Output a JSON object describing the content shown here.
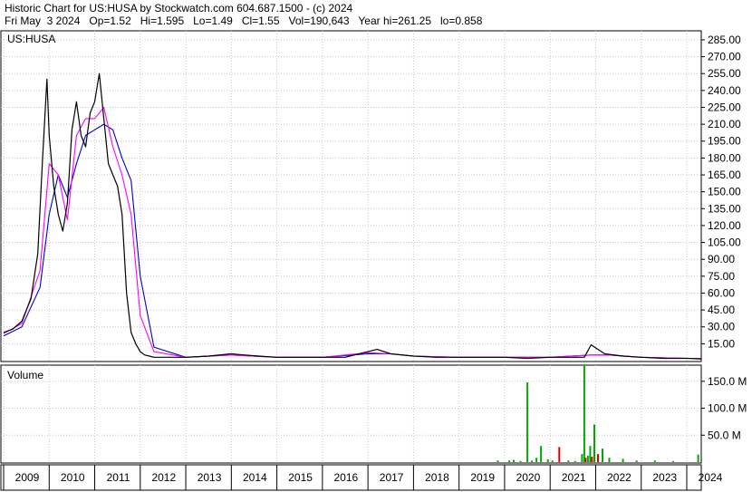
{
  "header": {
    "line1": "Historic Chart for US:HUSA by Stockwatch.com 604.687.1500 - (c) 2024",
    "line2": "Fri May  3 2024   Op=1.52   Hi=1.595   Lo=1.49   Cl=1.55   Vol=190,643   Year hi=261.25   lo=0.858"
  },
  "price_panel": {
    "symbol_label": "US:HUSA"
  },
  "volume_panel": {
    "label": "Volume"
  },
  "colors": {
    "price": "#000000",
    "ma_short": "#ff00ff",
    "ma_long": "#0000cc",
    "vol_up": "#00aa00",
    "vol_down": "#dd0000",
    "grid": "#c8c8c8"
  },
  "chart_data": [
    {
      "type": "line",
      "title": "",
      "xlabel": "",
      "ylabel": "",
      "ylim": [
        0,
        293
      ],
      "yticks": [
        "285.00",
        "270.00",
        "255.00",
        "240.00",
        "225.00",
        "210.00",
        "195.00",
        "180.00",
        "165.00",
        "150.00",
        "135.00",
        "120.00",
        "105.00",
        "90.00",
        "75.00",
        "60.00",
        "45.00",
        "30.00",
        "15.00"
      ],
      "xticks": [
        "2009",
        "2010",
        "2011",
        "2012",
        "2013",
        "2014",
        "2015",
        "2016",
        "2017",
        "2018",
        "2019",
        "2020",
        "2021",
        "2022",
        "2023",
        "2024"
      ],
      "grid": true,
      "series": [
        {
          "x": [
            2009.0,
            2009.2,
            2009.4,
            2009.6,
            2009.75,
            2009.85,
            2009.95,
            2010.0,
            2010.1,
            2010.2,
            2010.3,
            2010.4,
            2010.5,
            2010.6,
            2010.7,
            2010.8,
            2010.9,
            2011.0,
            2011.1,
            2011.2,
            2011.3,
            2011.4,
            2011.5,
            2011.6,
            2011.7,
            2011.8,
            2011.9,
            2012.0,
            2012.1,
            2012.2,
            2012.3,
            2012.5,
            2012.7,
            2013.0,
            2013.5,
            2014.0,
            2014.3,
            2014.6,
            2015.0,
            2015.5,
            2016.0,
            2016.5,
            2017.0,
            2017.2,
            2017.5,
            2018.0,
            2018.5,
            2019.0,
            2019.5,
            2020.0,
            2020.5,
            2021.0,
            2021.5,
            2021.75,
            2021.9,
            2022.2,
            2022.6,
            2023.0,
            2023.5,
            2024.0,
            2024.33
          ],
          "y": [
            25,
            28,
            35,
            55,
            95,
            175,
            250,
            200,
            155,
            130,
            115,
            140,
            205,
            230,
            200,
            190,
            220,
            230,
            255,
            215,
            175,
            165,
            155,
            130,
            60,
            25,
            15,
            8,
            5,
            4,
            3,
            3,
            3,
            3,
            4,
            6,
            5,
            4,
            3,
            3,
            3,
            3,
            8,
            10,
            6,
            4,
            3,
            3,
            3,
            3,
            2,
            3,
            3,
            3,
            14,
            6,
            4,
            3,
            2,
            2,
            1.55
          ]
        },
        {
          "x": [
            2009.0,
            2009.4,
            2009.8,
            2010.0,
            2010.2,
            2010.4,
            2010.6,
            2010.8,
            2011.0,
            2011.2,
            2011.4,
            2011.6,
            2011.8,
            2012.0,
            2012.3,
            2013.0,
            2014.0,
            2015.0,
            2016.0,
            2017.0,
            2017.5,
            2018.0,
            2019.0,
            2020.0,
            2021.0,
            2021.9,
            2022.3,
            2023.0,
            2024.0,
            2024.33
          ],
          "y": [
            24,
            33,
            80,
            175,
            165,
            125,
            200,
            215,
            215,
            225,
            190,
            165,
            130,
            40,
            8,
            3,
            5,
            3,
            3,
            7,
            6,
            4,
            3,
            3,
            3,
            5,
            5,
            3,
            2,
            2
          ]
        },
        {
          "x": [
            2009.0,
            2009.4,
            2009.8,
            2010.0,
            2010.2,
            2010.4,
            2010.6,
            2010.8,
            2011.0,
            2011.2,
            2011.4,
            2011.6,
            2011.8,
            2012.0,
            2012.3,
            2013.0,
            2014.0,
            2015.0,
            2016.0,
            2017.0,
            2017.5,
            2018.0,
            2019.0,
            2020.0,
            2021.0,
            2021.9,
            2022.3,
            2023.0,
            2024.0,
            2024.33
          ],
          "y": [
            22,
            30,
            65,
            130,
            165,
            145,
            175,
            200,
            205,
            210,
            205,
            180,
            160,
            75,
            12,
            3,
            5,
            3,
            3,
            6,
            6,
            4,
            3,
            3,
            3,
            5,
            5,
            3,
            2,
            2
          ]
        }
      ]
    },
    {
      "type": "bar",
      "title": "",
      "xlabel": "",
      "ylabel": "",
      "ylim": [
        0,
        180
      ],
      "yticks": [
        "150.0 M",
        "100.0 M",
        "50.0 M"
      ],
      "x": [
        2019.85,
        2020.1,
        2020.2,
        2020.35,
        2020.5,
        2020.6,
        2020.7,
        2020.8,
        2020.95,
        2021.05,
        2021.2,
        2021.4,
        2021.55,
        2021.7,
        2021.75,
        2021.78,
        2021.83,
        2021.88,
        2021.92,
        2021.97,
        2022.05,
        2022.15,
        2022.3,
        2022.6,
        2022.9,
        2023.3,
        2023.7,
        2024.25
      ],
      "values": [
        3,
        3,
        4,
        2,
        148,
        3,
        8,
        30,
        5,
        3,
        28,
        3,
        2,
        15,
        185,
        8,
        12,
        30,
        10,
        70,
        15,
        25,
        8,
        6,
        3,
        3,
        2,
        14
      ],
      "colors": [
        "up",
        "up",
        "up",
        "up",
        "up",
        "up",
        "up",
        "up",
        "up",
        "up",
        "down",
        "up",
        "up",
        "up",
        "up",
        "down",
        "up",
        "up",
        "down",
        "up",
        "down",
        "up",
        "up",
        "up",
        "up",
        "up",
        "up",
        "up"
      ]
    }
  ]
}
